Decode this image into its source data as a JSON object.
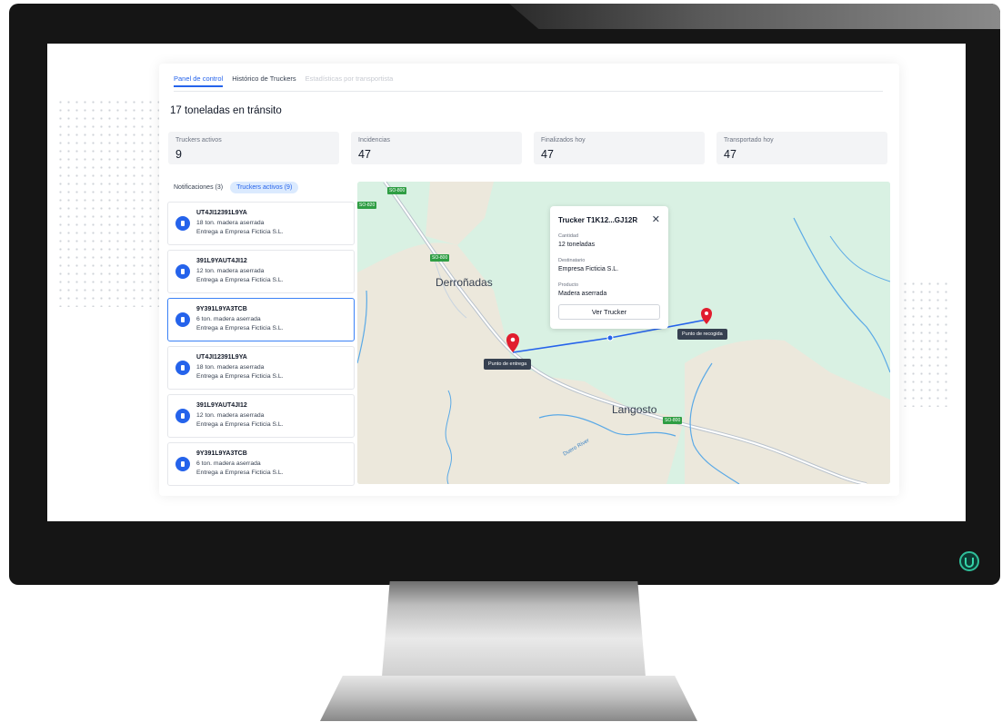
{
  "tabs": [
    {
      "label": "Panel de control",
      "state": "active"
    },
    {
      "label": "Histórico de Truckers",
      "state": "normal"
    },
    {
      "label": "Estadísticas por transportista",
      "state": "disabled"
    }
  ],
  "heading": "17 toneladas en tránsito",
  "stats": [
    {
      "label": "Truckers activos",
      "value": "9"
    },
    {
      "label": "Incidencias",
      "value": "47"
    },
    {
      "label": "Finalizados hoy",
      "value": "47"
    },
    {
      "label": "Transportado hoy",
      "value": "47"
    }
  ],
  "list_tabs": {
    "notifications": "Notificaciones (3)",
    "active": "Truckers activos (9)"
  },
  "truckers": [
    {
      "id": "UT4JI12391L9YA",
      "load": "18 ton. madera aserrada",
      "dest": "Entrega a Empresa Ficticia S.L."
    },
    {
      "id": "391L9YAUT4JI12",
      "load": "12 ton. madera aserrada",
      "dest": "Entrega a Empresa Ficticia S.L."
    },
    {
      "id": "9Y391L9YA3TCB",
      "load": "6 ton. madera aserrada",
      "dest": "Entrega a Empresa Ficticia S.L.",
      "selected": true
    },
    {
      "id": "UT4JI12391L9YA",
      "load": "18 ton. madera aserrada",
      "dest": "Entrega a Empresa Ficticia S.L."
    },
    {
      "id": "391L9YAUT4JI12",
      "load": "12 ton. madera aserrada",
      "dest": "Entrega a Empresa Ficticia S.L."
    },
    {
      "id": "9Y391L9YA3TCB",
      "load": "6 ton. madera aserrada",
      "dest": "Entrega a Empresa Ficticia S.L."
    }
  ],
  "popup": {
    "title": "Trucker T1K12...GJ12R",
    "close": "✕",
    "qty_label": "Cantidad",
    "qty": "12 toneladas",
    "dest_label": "Destinatario",
    "dest": "Empresa Ficticia S.L.",
    "prod_label": "Producto",
    "prod": "Madera aserrada",
    "button": "Ver Trucker"
  },
  "map": {
    "places": [
      "Derroñadas",
      "Langosto"
    ],
    "roads": [
      "SO-800",
      "SO-820",
      "SO-800",
      "SO-800"
    ],
    "river": "Duero River",
    "delivery": "Punto de entrega",
    "pickup": "Punto de recogida"
  },
  "colors": {
    "accent": "#2563eb",
    "marker": "#e11d2e",
    "route": "#2563eb",
    "power": "#2fbf9a"
  }
}
